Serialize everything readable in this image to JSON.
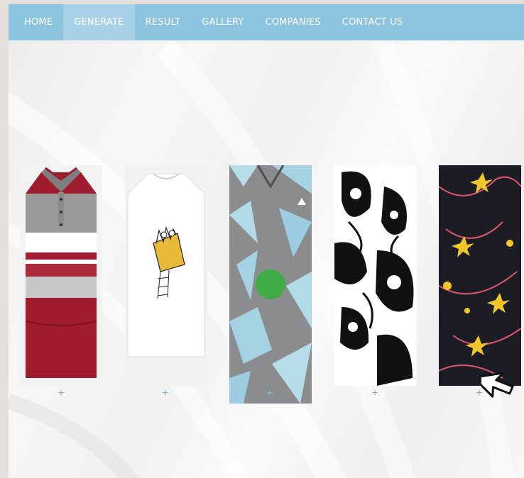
{
  "nav": {
    "items": [
      {
        "label": "HOME"
      },
      {
        "label": "GENERATE"
      },
      {
        "label": "RESULT"
      },
      {
        "label": "GALLERY"
      },
      {
        "label": "COMPANIES"
      },
      {
        "label": "CONTACT US"
      }
    ],
    "active_index": 1
  },
  "gallery": {
    "items": [
      {
        "name": "polo-shirt-image",
        "add_label": "+"
      },
      {
        "name": "white-tshirt-image",
        "add_label": "+"
      },
      {
        "name": "geometric-jacket-image",
        "add_label": "+"
      },
      {
        "name": "paisley-pattern-image",
        "add_label": "+"
      },
      {
        "name": "floral-pattern-image",
        "add_label": "+"
      }
    ]
  },
  "colors": {
    "navbar": "#8cc3df",
    "active_tab": "#a6d1e7",
    "plus": "#7cb5d2",
    "marker": "#3eab45"
  }
}
